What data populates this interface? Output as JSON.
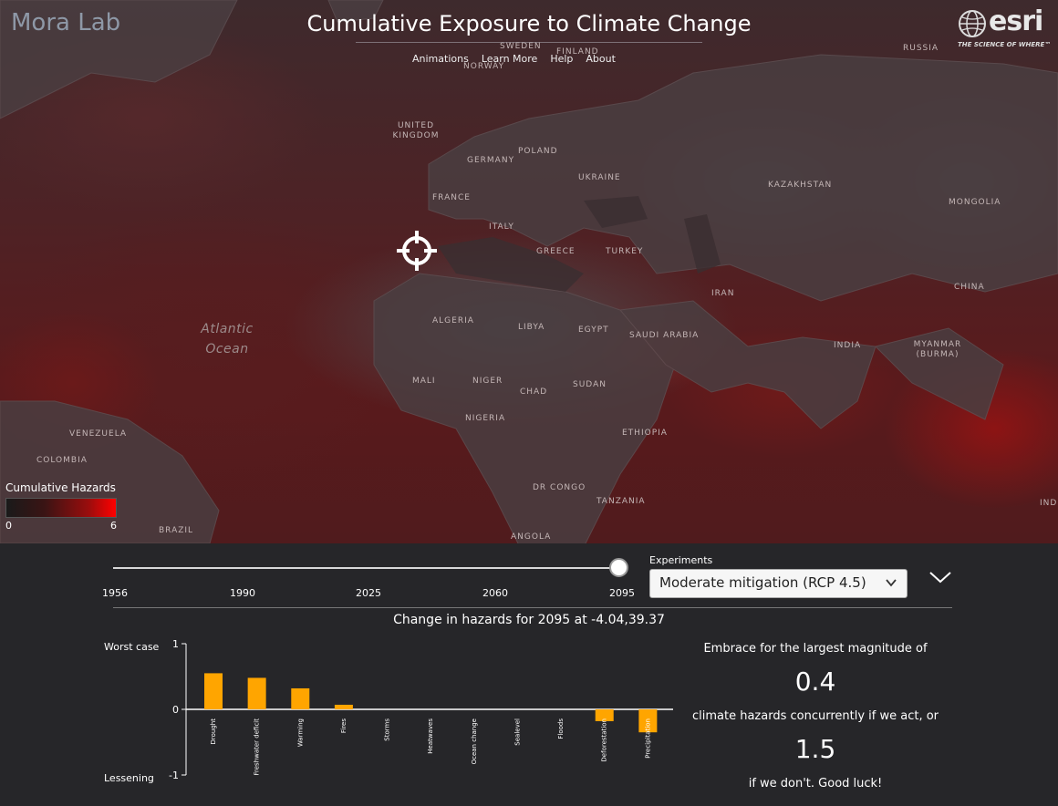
{
  "brand": "Mora Lab",
  "app_title": "Cumulative Exposure to Climate Change",
  "nav": [
    "Animations",
    "Learn More",
    "Help",
    "About"
  ],
  "esri": {
    "wordmark": "esri",
    "tagline": "THE SCIENCE OF WHERE™",
    "icon": "globe-icon"
  },
  "map": {
    "country_labels": [
      "SWEDEN",
      "FINLAND",
      "NORWAY",
      "RUSSIA",
      "UNITED KINGDOM",
      "POLAND",
      "GERMANY",
      "UKRAINE",
      "FRANCE",
      "KAZAKHSTAN",
      "MONGOLIA",
      "ITALY",
      "GREECE",
      "TURKEY",
      "IRAN",
      "CHINA",
      "ALGERIA",
      "LIBYA",
      "EGYPT",
      "SAUDI ARABIA",
      "INDIA",
      "MYANMAR (BURMA)",
      "MALI",
      "NIGER",
      "CHAD",
      "SUDAN",
      "NIGERIA",
      "ETHIOPIA",
      "VENEZUELA",
      "COLOMBIA",
      "DR CONGO",
      "TANZANIA",
      "BRAZIL",
      "ANGOLA",
      "IND"
    ],
    "ocean_label": "Atlantic Ocean",
    "target_icon": "crosshair-icon"
  },
  "legend": {
    "title": "Cumulative Hazards",
    "min": "0",
    "max": "6",
    "colors": [
      "#1a1a1a",
      "#ff0000"
    ]
  },
  "timeline": {
    "years": [
      "1956",
      "1990",
      "2025",
      "2060",
      "2095"
    ],
    "selected": "2095",
    "selected_fraction": 1.0
  },
  "experiments": {
    "label": "Experiments",
    "selected": "Moderate mitigation (RCP 4.5)"
  },
  "change_title": "Change in hazards for 2095 at -4.04,39.37",
  "chart_data": {
    "type": "bar",
    "categories": [
      "Drought",
      "Freshwater deficit",
      "Warming",
      "Fires",
      "Storms",
      "Heatwaves",
      "Ocean change",
      "Sealevel",
      "Floods",
      "Deforestation",
      "Precipitation"
    ],
    "values": [
      0.55,
      0.48,
      0.32,
      0.07,
      0,
      0,
      0,
      0,
      0,
      -0.18,
      -0.35
    ],
    "ylim": [
      -1,
      1
    ],
    "yticks": [
      "1",
      "0",
      "-1"
    ],
    "top_label": "Worst case",
    "bottom_label": "Lessening",
    "bar_color": "#ffa500"
  },
  "summary": {
    "line1": "Embrace for the largest magnitude of",
    "value_act": "0.4",
    "line2": "climate hazards concurrently if we act, or",
    "value_dont": "1.5",
    "line3": "if we don't. Good luck!"
  }
}
